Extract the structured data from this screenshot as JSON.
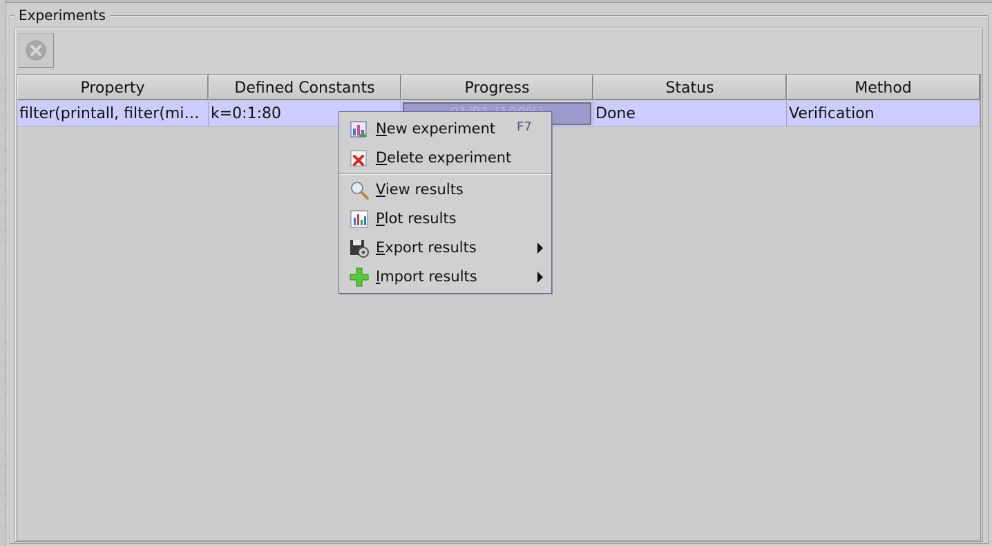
{
  "panel": {
    "title": "Experiments"
  },
  "toolbar": {
    "stop_icon": "stop-circle-icon"
  },
  "table": {
    "columns": [
      "Property",
      "Defined Constants",
      "Progress",
      "Status",
      "Method"
    ],
    "rows": [
      {
        "property": "filter(printall, filter(mi…",
        "constants": "k=0:1:80",
        "progress": "81/81 (100%)",
        "progress_fraction": 1.0,
        "status": "Done",
        "method": "Verification"
      }
    ]
  },
  "context_menu": {
    "items": [
      {
        "mnemonic": "N",
        "rest": "ew experiment",
        "accelerator": "F7",
        "icon": "new-experiment-icon",
        "submenu": false
      },
      {
        "mnemonic": "D",
        "rest": "elete experiment",
        "accelerator": "",
        "icon": "delete-icon",
        "submenu": false
      },
      {
        "mnemonic": "V",
        "rest": "iew results",
        "accelerator": "",
        "icon": "magnifier-icon",
        "submenu": false
      },
      {
        "mnemonic": "P",
        "rest": "lot results",
        "accelerator": "",
        "icon": "bar-chart-icon",
        "submenu": false
      },
      {
        "mnemonic": "E",
        "rest": "xport results",
        "accelerator": "",
        "icon": "export-disk-icon",
        "submenu": true
      },
      {
        "mnemonic": "I",
        "rest": "mport results",
        "accelerator": "",
        "icon": "plus-icon",
        "submenu": true
      }
    ]
  },
  "colors": {
    "selection": "#ccccff",
    "background": "#cfcfcf"
  }
}
